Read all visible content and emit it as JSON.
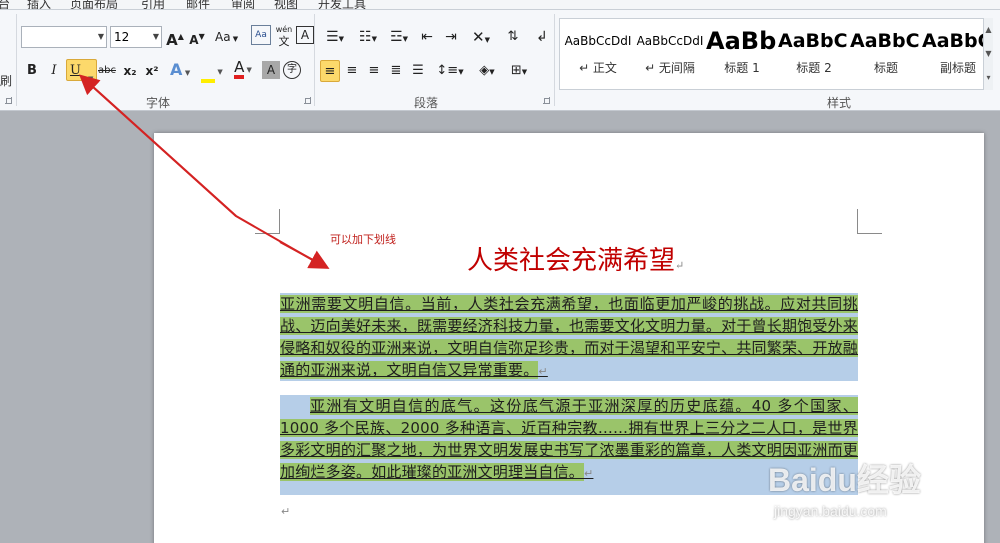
{
  "tabs": [
    "台",
    "插入",
    "页面布局",
    "引用",
    "邮件",
    "审阅",
    "视图",
    "开发工具"
  ],
  "ribbon": {
    "left_partial_label": "刷",
    "font_group": {
      "label": "字体",
      "font_name": "",
      "font_size": "12",
      "grow_font": "A",
      "shrink_font": "A",
      "change_case": "Aa",
      "bold": "B",
      "italic": "I",
      "underline": "U",
      "strikethrough": "abc",
      "subscript": "x₂",
      "superscript": "x²",
      "text_effect": "A",
      "font_color": "A",
      "char_shading": "A",
      "enclose": "字",
      "phonetic": "wén",
      "border_char": "A"
    },
    "paragraph_group": {
      "label": "段落"
    },
    "styles_group": {
      "label": "样式",
      "items": [
        {
          "sample": "AaBbCcDdI",
          "name": "↵ 正文"
        },
        {
          "sample": "AaBbCcDdI",
          "name": "↵ 无间隔"
        },
        {
          "sample": "AaBb",
          "name": "标题 1"
        },
        {
          "sample": "AaBbC",
          "name": "标题 2"
        },
        {
          "sample": "AaBbC",
          "name": "标题"
        },
        {
          "sample": "AaBbC",
          "name": "副标题"
        }
      ]
    }
  },
  "annotation": {
    "note": "可以加下划线",
    "arrow_color": "#d42323"
  },
  "document": {
    "title": "人类社会充满希望",
    "paragraph1": "亚洲需要文明自信。当前，人类社会充满希望，也面临更加严峻的挑战。应对共同挑战、迈向美好未来，既需要经济科技力量，也需要文化文明力量。对于曾长期饱受外来侵略和奴役的亚洲来说，文明自信弥足珍贵，而对于渴望和平安宁、共同繁荣、开放融通的亚洲来说，文明自信又异常重要。",
    "paragraph2": "亚洲有文明自信的底气。这份底气源于亚洲深厚的历史底蕴。40 多个国家、1000 多个民族、2000 多种语言、近百种宗教……拥有世界上三分之二人口，是世界多彩文明的汇聚之地，为世界文明发展史书写了浓墨重彩的篇章，人类文明因亚洲而更加绚烂多姿。如此璀璨的亚洲文明理当自信。",
    "highlight_color": "#9ac46a",
    "selection_color": "#b6cee8",
    "title_color": "#c00000"
  },
  "watermark": {
    "brand": "Baidu经验",
    "url": "jingyan.baidu.com"
  }
}
